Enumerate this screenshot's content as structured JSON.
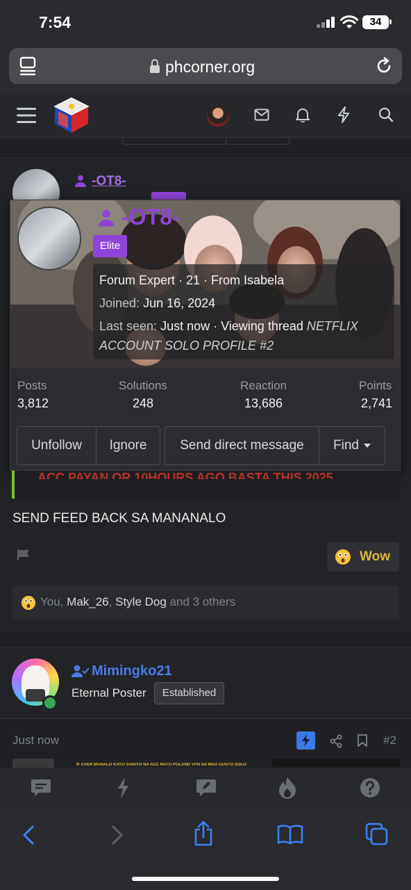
{
  "status_bar": {
    "time": "7:54",
    "battery": "34"
  },
  "browser": {
    "url": "phcorner.org"
  },
  "site_nav": {
    "icons": [
      "menu-icon",
      "logo",
      "avatar",
      "mail-icon",
      "bell-icon",
      "bolt-icon",
      "search-icon"
    ]
  },
  "post1": {
    "username": "-OT8-",
    "feed_text": "SEND FEED BACK SA MANANALO",
    "quote_text": "ACC PAYAN OR 10HOURS AGO BASTA THIS 2025",
    "reaction_button": "Wow",
    "reactions": {
      "you": "You,",
      "user1": "Mak_26",
      "comma": ",",
      "user2": "Style Dog",
      "others": "and 3 others"
    }
  },
  "profile_popup": {
    "username": "-OT8-",
    "badge": "Elite",
    "line1": "Forum Expert · 21 · From Isabela",
    "joined_label": "Joined:",
    "joined_value": "Jun 16, 2024",
    "last_seen_label": "Last seen:",
    "last_seen_value": "Just now · Viewing thread",
    "thread_title_1": "NETFLIX",
    "thread_title_2": "ACCOUNT SOLO PROFILE #2",
    "stats": [
      {
        "label": "Posts",
        "value": "3,812"
      },
      {
        "label": "Solutions",
        "value": "248"
      },
      {
        "label": "Reaction",
        "value": "13,686"
      },
      {
        "label": "Points",
        "value": "2,741"
      }
    ],
    "buttons": {
      "unfollow": "Unfollow",
      "ignore": "Ignore",
      "message": "Send direct message",
      "find": "Find"
    }
  },
  "post2": {
    "username": "Mimingko21",
    "title": "Eternal Poster",
    "badge": "Established",
    "time": "Just now",
    "post_number": "#2",
    "preview_text": "IF EVER MANALO KAYO SAINYO NA ACC NATO POLAND VPN SA MGA GUSTO SOLO"
  },
  "colors": {
    "accent_purple": "#8e44d8",
    "link_blue": "#4c7be8",
    "online_green": "#3aa655",
    "quote_green": "#7cbf2e",
    "wow_gold": "#e0b43a"
  }
}
